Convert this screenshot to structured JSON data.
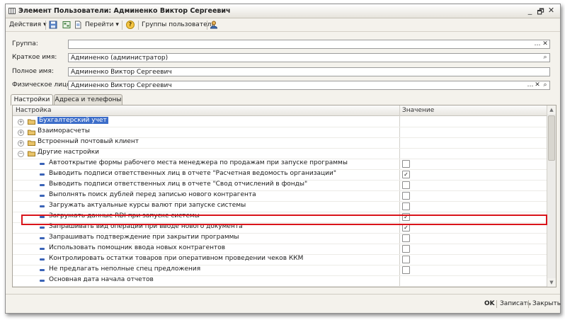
{
  "window": {
    "title": "Элемент Пользователи: Админенко Виктор Сергеевич",
    "controls": {
      "minimize": "_",
      "restore": "🗗",
      "close": "✕"
    }
  },
  "toolbar": {
    "actions": "Действия",
    "goto": "Перейти",
    "help": "?",
    "user_groups": "Группы пользователя"
  },
  "form": {
    "group": {
      "label": "Группа:",
      "value": ""
    },
    "short_name": {
      "label": "Краткое имя:",
      "value": "Админенко (администратор)"
    },
    "full_name": {
      "label": "Полное имя:",
      "value": "Админенко Виктор Сергеевич"
    },
    "person": {
      "label": "Физическое лицо:",
      "value": "Админенко Виктор Сергеевич"
    }
  },
  "tabs": [
    {
      "label": "Настройки",
      "active": true
    },
    {
      "label": "Адреса и телефоны",
      "active": false
    }
  ],
  "grid": {
    "columns": [
      "Настройка",
      "Значение"
    ],
    "rows": [
      {
        "type": "group",
        "label": "Бухгалтерский учет",
        "expanded": false,
        "selected": true
      },
      {
        "type": "group",
        "label": "Взаиморасчеты",
        "expanded": false
      },
      {
        "type": "group",
        "label": "Встроенный почтовый клиент",
        "expanded": false
      },
      {
        "type": "group",
        "label": "Другие настройки",
        "expanded": true
      },
      {
        "type": "item",
        "label": "Автооткрытие формы рабочего места менеджера по продажам при запуске программы",
        "checked": false
      },
      {
        "type": "item",
        "label": "Выводить подписи ответственных лиц в отчете \"Расчетная ведомость организации\"",
        "checked": true
      },
      {
        "type": "item",
        "label": "Выводить подписи ответственных лиц в отчете \"Свод отчислений в фонды\"",
        "checked": false
      },
      {
        "type": "item",
        "label": "Выполнять поиск дублей перед записью нового контрагента",
        "checked": false
      },
      {
        "type": "item",
        "label": "Загружать актуальные курсы валют при запуске системы",
        "checked": false
      },
      {
        "type": "item",
        "label": "Загружать данные RDI при запуске системы",
        "checked": true,
        "highlighted": true
      },
      {
        "type": "item",
        "label": "Запрашивать вид операции при вводе нового документа",
        "checked": true
      },
      {
        "type": "item",
        "label": "Запрашивать подтверждение при закрытии программы",
        "checked": false
      },
      {
        "type": "item",
        "label": "Использовать помощник ввода новых контрагентов",
        "checked": false
      },
      {
        "type": "item",
        "label": "Контролировать остатки товаров при оперативном проведении чеков ККМ",
        "checked": false
      },
      {
        "type": "item",
        "label": "Не предлагать неполные спец предложения",
        "checked": false
      },
      {
        "type": "item",
        "label": "Основная дата начала отчетов"
      }
    ]
  },
  "buttons": {
    "ok": "OK",
    "save": "Записать",
    "close": "Закрыть"
  },
  "colors": {
    "highlight": "#d9141a",
    "selection": "#3c6dc9",
    "item_marker": "#3a63b7"
  }
}
